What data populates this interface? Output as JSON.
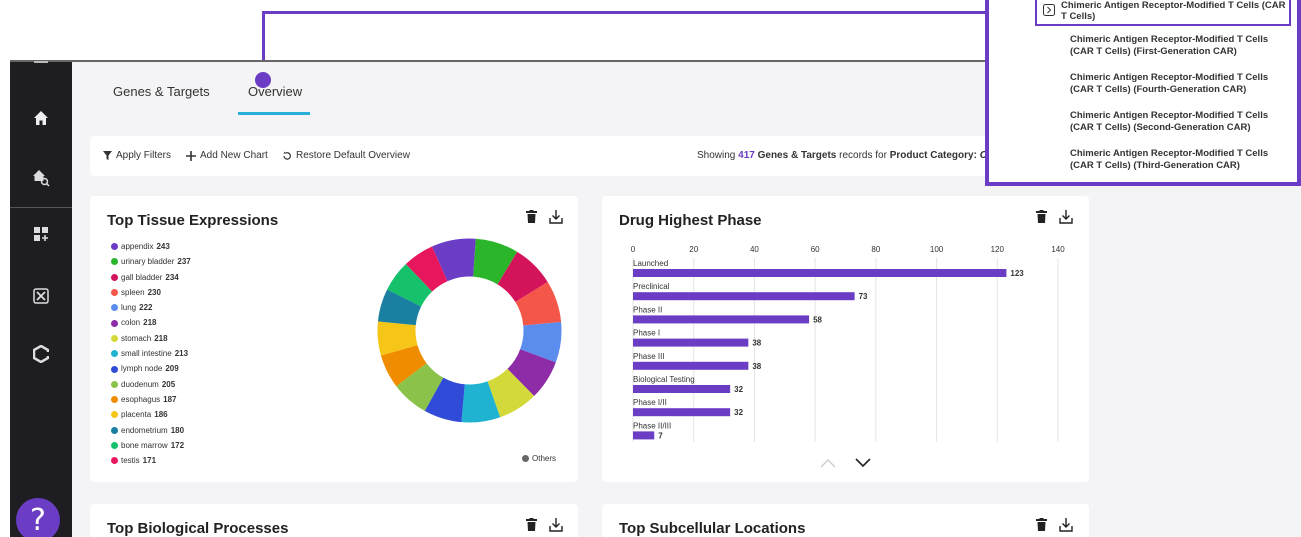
{
  "tabs": [
    {
      "label": "Genes & Targets"
    },
    {
      "label": "Overview"
    }
  ],
  "toolbar": {
    "apply_filters": "Apply Filters",
    "add_new_chart": "Add New Chart",
    "restore_default": "Restore Default Overview",
    "showing_prefix": "Showing",
    "record_count": "417",
    "record_type": "Genes & Targets",
    "records_for": "records for",
    "product_category_label": "Product Category:",
    "product_category_value": "Ch"
  },
  "cards": {
    "tissue": {
      "title": "Top Tissue Expressions",
      "others": "Others"
    },
    "phase": {
      "title": "Drug Highest Phase"
    },
    "bio": {
      "title": "Top Biological Processes"
    },
    "subcell": {
      "title": "Top Subcellular Locations"
    }
  },
  "tissue_legend": [
    {
      "name": "appendix",
      "value": "243",
      "color": "#6a3dc4"
    },
    {
      "name": "urinary bladder",
      "value": "237",
      "color": "#2bb52b"
    },
    {
      "name": "gall bladder",
      "value": "234",
      "color": "#d4145a"
    },
    {
      "name": "spleen",
      "value": "230",
      "color": "#f4574a"
    },
    {
      "name": "lung",
      "value": "222",
      "color": "#5b8def"
    },
    {
      "name": "colon",
      "value": "218",
      "color": "#8e2ca8"
    },
    {
      "name": "stomach",
      "value": "218",
      "color": "#d4d93a"
    },
    {
      "name": "small intestine",
      "value": "213",
      "color": "#1fb3d1"
    },
    {
      "name": "lymph node",
      "value": "209",
      "color": "#2f4bd8"
    },
    {
      "name": "duodenum",
      "value": "205",
      "color": "#8bc34a"
    },
    {
      "name": "esophagus",
      "value": "187",
      "color": "#f08c00"
    },
    {
      "name": "placenta",
      "value": "186",
      "color": "#f5c518"
    },
    {
      "name": "endometrium",
      "value": "180",
      "color": "#1a7fa0"
    },
    {
      "name": "bone marrow",
      "value": "172",
      "color": "#15c26b"
    },
    {
      "name": "testis",
      "value": "171",
      "color": "#e8175d"
    }
  ],
  "popup": {
    "header": "Chimeric Antigen Receptor-Modified T Cells (CAR T Cells)",
    "items": [
      {
        "line1": "Chimeric Antigen Receptor-Modified T Cells",
        "line2": "(CAR T Cells) (First-Generation CAR)"
      },
      {
        "line1": "Chimeric Antigen Receptor-Modified T Cells",
        "line2": "(CAR T Cells) (Fourth-Generation CAR)"
      },
      {
        "line1": "Chimeric Antigen Receptor-Modified T Cells",
        "line2": "(CAR T Cells) (Second-Generation CAR)"
      },
      {
        "line1": "Chimeric Antigen Receptor-Modified T Cells",
        "line2": "(CAR T Cells) (Third-Generation CAR)"
      }
    ]
  },
  "colors": {
    "accent": "#6a3dc4",
    "tab_underline": "#2ab0d8",
    "others": "#666666"
  },
  "chart_data": [
    {
      "type": "pie",
      "title": "Top Tissue Expressions",
      "donut": true,
      "slices": [
        {
          "label": "appendix",
          "value": 243,
          "color": "#6a3dc4"
        },
        {
          "label": "urinary bladder",
          "value": 237,
          "color": "#2bb52b"
        },
        {
          "label": "gall bladder",
          "value": 234,
          "color": "#d4145a"
        },
        {
          "label": "spleen",
          "value": 230,
          "color": "#f4574a"
        },
        {
          "label": "lung",
          "value": 222,
          "color": "#5b8def"
        },
        {
          "label": "colon",
          "value": 218,
          "color": "#8e2ca8"
        },
        {
          "label": "stomach",
          "value": 218,
          "color": "#d4d93a"
        },
        {
          "label": "small intestine",
          "value": 213,
          "color": "#1fb3d1"
        },
        {
          "label": "lymph node",
          "value": 209,
          "color": "#2f4bd8"
        },
        {
          "label": "duodenum",
          "value": 205,
          "color": "#8bc34a"
        },
        {
          "label": "esophagus",
          "value": 187,
          "color": "#f08c00"
        },
        {
          "label": "placenta",
          "value": 186,
          "color": "#f5c518"
        },
        {
          "label": "endometrium",
          "value": 180,
          "color": "#1a7fa0"
        },
        {
          "label": "bone marrow",
          "value": 172,
          "color": "#15c26b"
        },
        {
          "label": "testis",
          "value": 171,
          "color": "#e8175d"
        }
      ],
      "legend": "left"
    },
    {
      "type": "bar",
      "orientation": "horizontal",
      "title": "Drug Highest Phase",
      "categories": [
        "Launched",
        "Preclinical",
        "Phase II",
        "Phase I",
        "Phase III",
        "Biological Testing",
        "Phase I/II",
        "Phase II/III"
      ],
      "values": [
        123,
        73,
        58,
        38,
        38,
        32,
        32,
        7
      ],
      "xlim": [
        0,
        140
      ],
      "xticks": [
        0,
        20,
        40,
        60,
        80,
        100,
        120,
        140
      ],
      "grid": true,
      "color": "#6a3dc4"
    }
  ]
}
